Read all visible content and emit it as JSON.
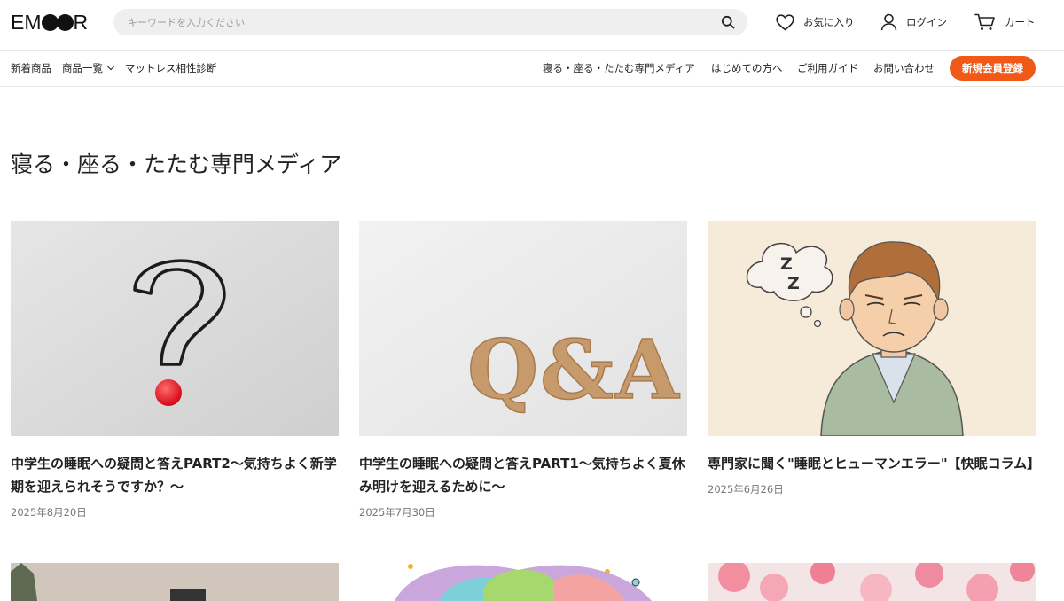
{
  "header": {
    "logo_text": "EMOOR",
    "search_placeholder": "キーワードを入力ください",
    "favorites_label": "お気に入り",
    "login_label": "ログイン",
    "cart_label": "カート"
  },
  "nav": {
    "left": [
      "新着商品",
      "商品一覧",
      "マットレス相性診断"
    ],
    "right": [
      "寝る・座る・たたむ専門メディア",
      "はじめての方へ",
      "ご利用ガイド",
      "お問い合わせ"
    ],
    "cta_label": "新規会員登録"
  },
  "main": {
    "title": "寝る・座る・たたむ専門メディア",
    "articles": [
      {
        "title": "中学生の睡眠への疑問と答えPART2〜気持ちよく新学期を迎えられそうですか？〜",
        "date": "2025年8月20日",
        "image": "question-mark-image"
      },
      {
        "title": "中学生の睡眠への疑問と答えPART1〜気持ちよく夏休み明けを迎えるために〜",
        "date": "2025年7月30日",
        "image": "qa-letters-image",
        "image_text": "Q&A"
      },
      {
        "title": "専門家に聞く\"睡眠とヒューマンエラー\"【快眠コラム】",
        "date": "2025年6月26日",
        "image": "sleepy-man-illustration",
        "image_text": "Z\nZ"
      }
    ]
  },
  "colors": {
    "accent": "#f15a16",
    "search_bg": "#efefef"
  }
}
